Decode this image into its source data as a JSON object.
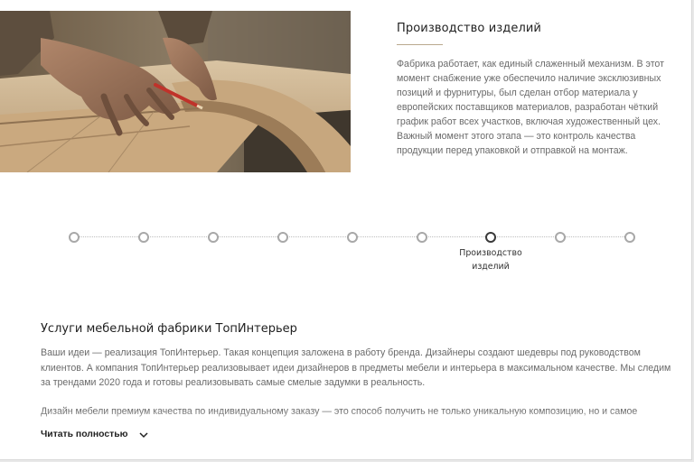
{
  "hero": {
    "title": "Производство изделий",
    "text": "Фабрика работает, как единый слаженный механизм. В этот момент снабжение уже обеспечило наличие эксклюзивных позиций и фурнитуры, был сделан отбор материала у европейских поставщиков материалов, разработан чёткий график работ всех участков, включая художественный цех. Важный момент этого этапа — это контроль качества продукции перед упаковкой и отправкой на монтаж."
  },
  "timeline": {
    "step_count": 9,
    "active_index": 6,
    "active_label_line1": "Производство",
    "active_label_line2": "изделий"
  },
  "services": {
    "title": "Услуги мебельной фабрики ТопИнтерьер",
    "paragraph1": "Ваши идеи — реализация ТопИнтерьер. Такая концепция заложена в работу бренда. Дизайнеры создают шедевры под руководством клиентов. А компания ТопИнтерьер реализовывает идеи дизайнеров в предметы мебели и интерьера в максимальном качестве. Мы следим за трендами 2020 года и готовы реализовывать самые смелые задумки в реальность.",
    "paragraph2": "Дизайн мебели премиум качества по индивидуальному заказу — это способ получить не только уникальную композицию, но и самое"
  },
  "read_more": {
    "label": "Читать полностью",
    "icon": "chevron-down-icon"
  },
  "colors": {
    "accent_underline": "#b9a98e",
    "active_step": "#3a3a3a",
    "inactive_step": "#a8a8a8"
  }
}
